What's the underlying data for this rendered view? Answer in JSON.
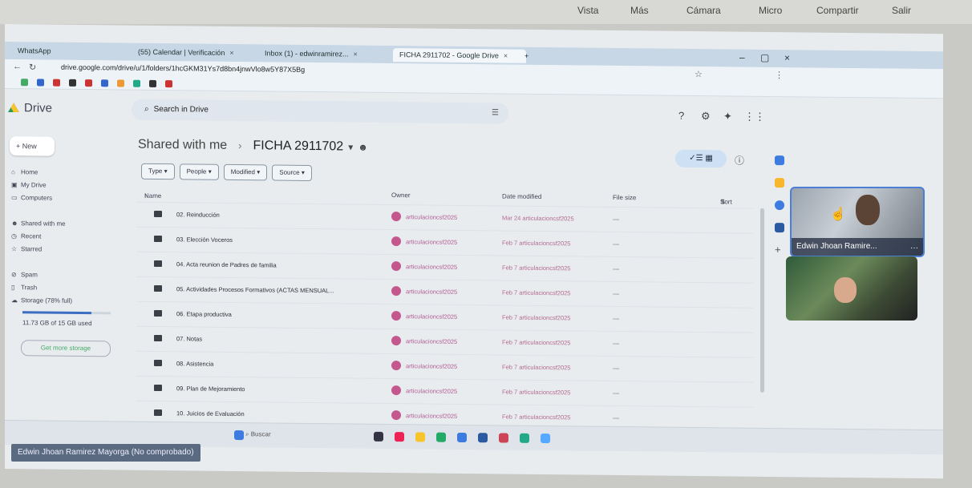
{
  "meet_bar": {
    "items": [
      "Vista",
      "Más",
      "Cámara",
      "Micro"
    ],
    "share_label": "Compartir",
    "exit_label": "Salir"
  },
  "browser": {
    "tabs": [
      {
        "label": "WhatsApp"
      },
      {
        "label": "(55) Calendar | Verificación"
      },
      {
        "label": "Inbox (1) - edwinramirez..."
      },
      {
        "label": "FICHA 2911702 - Google Drive"
      }
    ],
    "new_tab": "+",
    "url": "drive.google.com/drive/u/1/folders/1hcGKM31Ys7d8bn4jnwVlo8w5Y87X5Bg"
  },
  "drive": {
    "logo": "Drive",
    "search_placeholder": "Search in Drive",
    "new_label": "New",
    "nav": [
      {
        "label": "Home"
      },
      {
        "label": "My Drive"
      },
      {
        "label": "Computers"
      },
      {
        "label": "Shared with me"
      },
      {
        "label": "Recent"
      },
      {
        "label": "Starred"
      },
      {
        "label": "Spam"
      },
      {
        "label": "Trash"
      },
      {
        "label": "Storage (78% full)"
      }
    ],
    "storage_text": "11.73 GB of 15 GB used",
    "storage_fraction": 0.78,
    "get_storage": "Get more storage",
    "breadcrumb": {
      "parent": "Shared with me",
      "current": "FICHA 2911702"
    },
    "filters": [
      "Type",
      "People",
      "Modified",
      "Source"
    ],
    "columns": {
      "name": "Name",
      "owner": "Owner",
      "modified": "Date modified",
      "size": "File size",
      "sort": "Sort"
    },
    "files": [
      {
        "name": "02. Reinducción",
        "owner": "articulacioncsf2025",
        "modified": "Mar 24 articulacioncsf2025",
        "size": "—"
      },
      {
        "name": "03. Elección Voceros",
        "owner": "articulacioncsf2025",
        "modified": "Feb 7 articulacioncsf2025",
        "size": "—"
      },
      {
        "name": "04. Acta reunion de Padres de familia",
        "owner": "articulacioncsf2025",
        "modified": "Feb 7 articulacioncsf2025",
        "size": "—"
      },
      {
        "name": "05. Actividades Procesos Formativos (ACTAS MENSUAL...",
        "owner": "articulacioncsf2025",
        "modified": "Feb 7 articulacioncsf2025",
        "size": "—"
      },
      {
        "name": "06. Etapa productiva",
        "owner": "articulacioncsf2025",
        "modified": "Feb 7 articulacioncsf2025",
        "size": "—"
      },
      {
        "name": "07. Notas",
        "owner": "articulacioncsf2025",
        "modified": "Feb 7 articulacioncsf2025",
        "size": "—"
      },
      {
        "name": "08. Asistencia",
        "owner": "articulacioncsf2025",
        "modified": "Feb 7 articulacioncsf2025",
        "size": "—"
      },
      {
        "name": "09. Plan de Mejoramiento",
        "owner": "articulacioncsf2025",
        "modified": "Feb 7 articulacioncsf2025",
        "size": "—"
      },
      {
        "name": "10. Juicios de Evaluación",
        "owner": "articulacioncsf2025",
        "modified": "Feb 7 articulacioncsf2025",
        "size": "—"
      }
    ]
  },
  "taskbar": {
    "search": "Buscar"
  },
  "meeting": {
    "presenter_label": "Edwin Jhoan Ramirez Mayorga (No comprobado)",
    "participant1_name": "Edwin Jhoan Ramire...",
    "more_label": "···"
  },
  "colors": {
    "accent": "#4b7ed6",
    "owner_avatar": "#c3578e"
  }
}
